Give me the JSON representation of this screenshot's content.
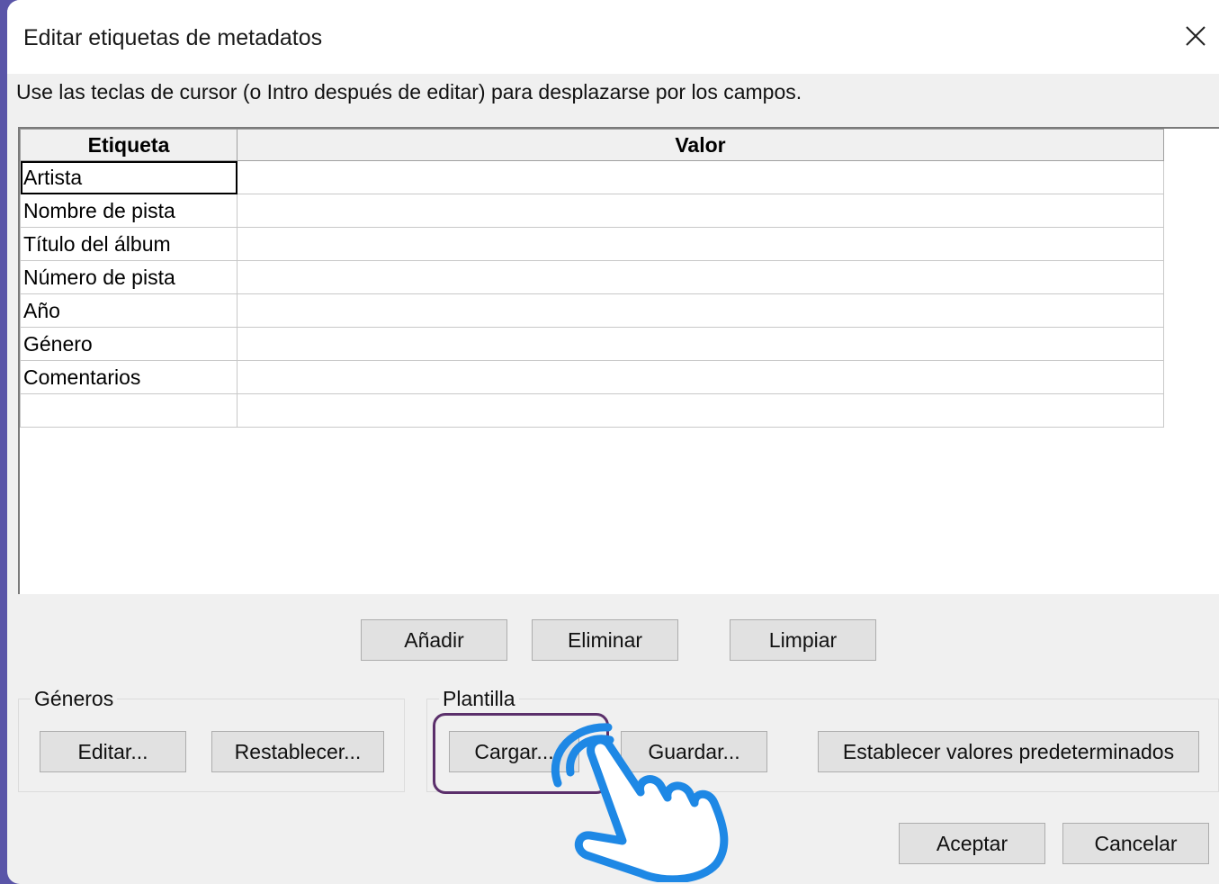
{
  "window": {
    "title": "Editar etiquetas de metadatos"
  },
  "instructions": "Use las teclas de cursor (o Intro después de editar) para desplazarse por los campos.",
  "grid": {
    "columns": [
      "Etiqueta",
      "Valor"
    ],
    "rows": [
      {
        "tag": "Artista",
        "value": ""
      },
      {
        "tag": "Nombre de pista",
        "value": ""
      },
      {
        "tag": "Título del álbum",
        "value": ""
      },
      {
        "tag": "Número de pista",
        "value": ""
      },
      {
        "tag": "Año",
        "value": ""
      },
      {
        "tag": "Género",
        "value": ""
      },
      {
        "tag": "Comentarios",
        "value": ""
      },
      {
        "tag": "",
        "value": ""
      }
    ]
  },
  "grid_buttons": {
    "add": "Añadir",
    "delete": "Eliminar",
    "clear": "Limpiar"
  },
  "genres": {
    "label": "Géneros",
    "edit": "Editar...",
    "reset": "Restablecer..."
  },
  "template": {
    "label": "Plantilla",
    "load": "Cargar...",
    "save": "Guardar...",
    "set_defaults": "Establecer valores predeterminados"
  },
  "footer": {
    "ok": "Aceptar",
    "cancel": "Cancelar"
  },
  "annotation": {
    "highlight_color": "#5b2f6b",
    "pointer_icon": "hand-pointer-icon",
    "pointer_color": "#1e88e5"
  }
}
